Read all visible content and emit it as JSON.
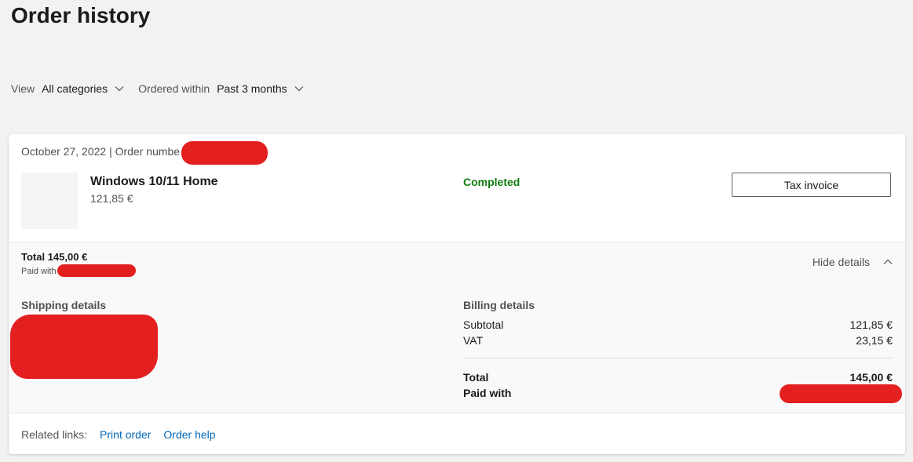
{
  "page": {
    "title": "Order history"
  },
  "filters": {
    "view_label": "View",
    "view_value": "All categories",
    "ordered_within_label": "Ordered within",
    "ordered_within_value": "Past 3 months"
  },
  "order": {
    "header_text": "October 27, 2022 | Order numbe",
    "product_name": "Windows 10/11 Home",
    "product_price": "121,85 €",
    "status": "Completed",
    "status_color": "#107c10",
    "tax_invoice_label": "Tax invoice",
    "total_label": "Total 145,00 €",
    "paid_with_label": "Paid with",
    "hide_details_label": "Hide details"
  },
  "details": {
    "shipping_title": "Shipping details",
    "billing_title": "Billing details",
    "billing_rows": [
      {
        "label": "Subtotal",
        "value": "121,85 €"
      },
      {
        "label": "VAT",
        "value": "23,15 €"
      }
    ],
    "total_label": "Total",
    "total_value": "145,00 €",
    "paid_with_label": "Paid with"
  },
  "related": {
    "label": "Related links:",
    "links": [
      {
        "label": "Print order"
      },
      {
        "label": "Order help"
      }
    ],
    "link_color": "#0067b8"
  },
  "icons": {
    "dropdown": "chevron-down-icon",
    "collapse": "chevron-up-icon"
  },
  "redaction_color": "#e31f1f"
}
